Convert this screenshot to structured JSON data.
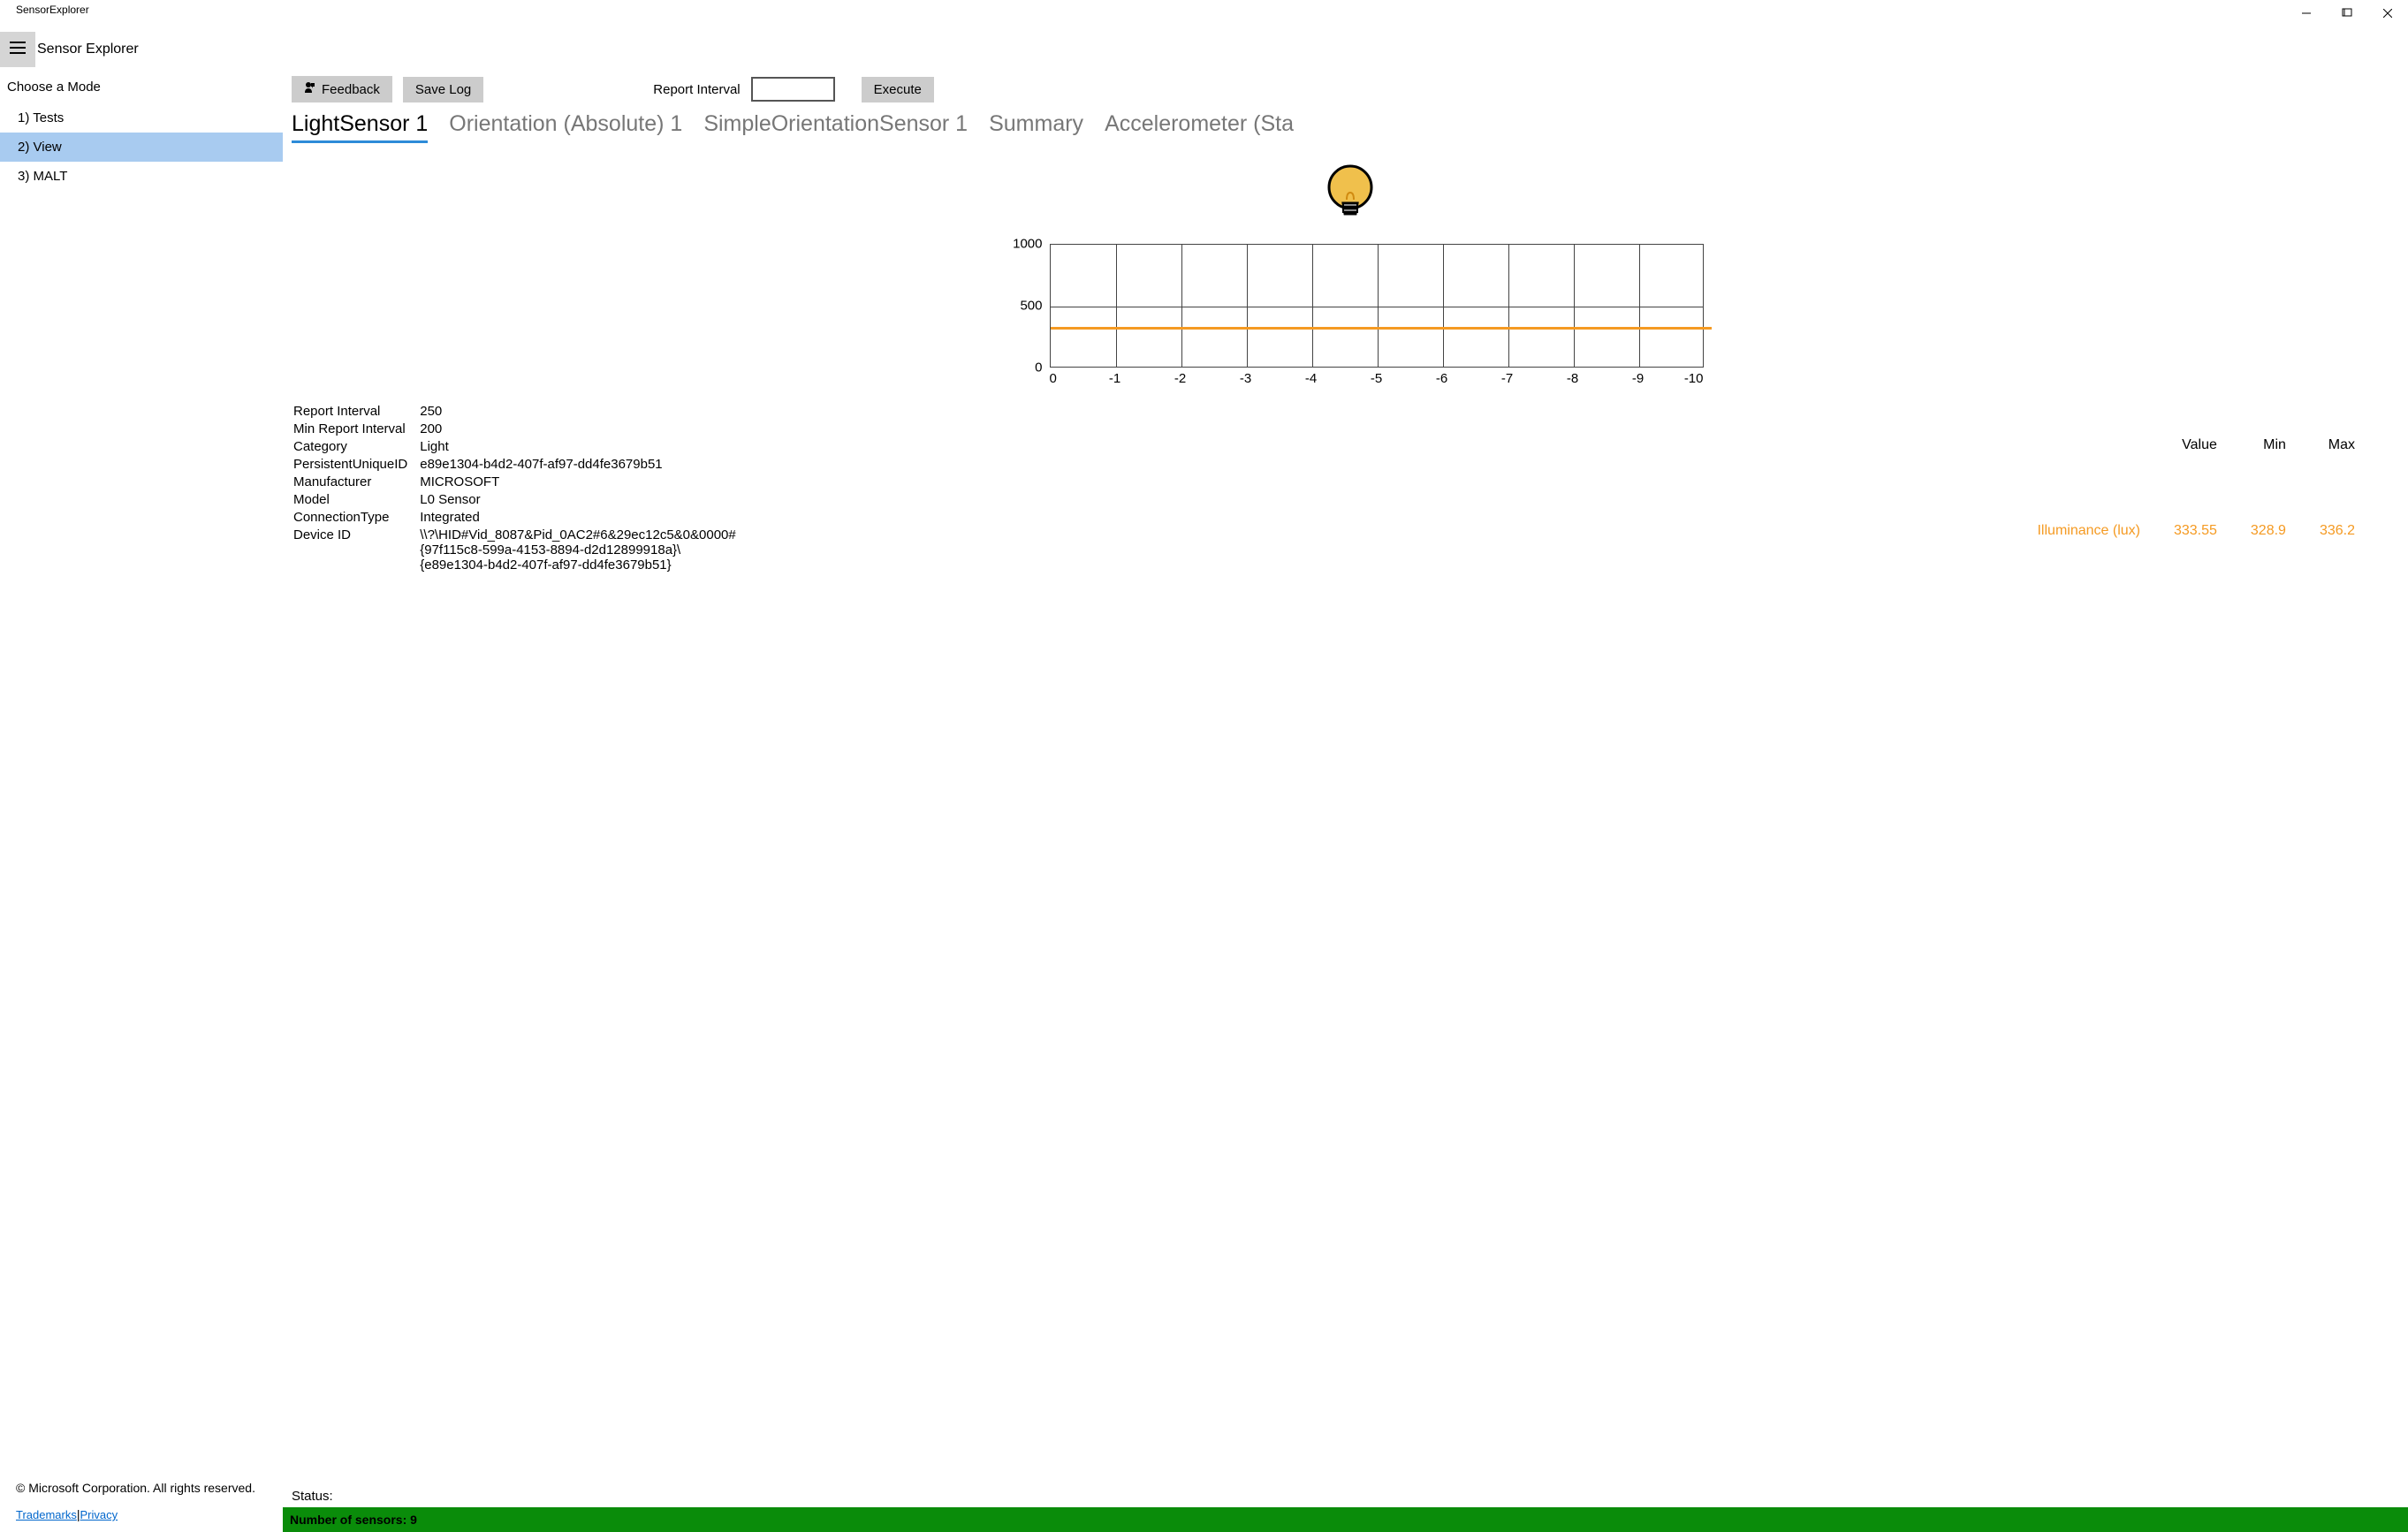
{
  "window": {
    "title": "SensorExplorer"
  },
  "header": {
    "app_title": "Sensor Explorer",
    "hamburger_icon": "menu-icon"
  },
  "sidebar": {
    "choose_label": "Choose a Mode",
    "items": [
      {
        "label": "1) Tests",
        "selected": false
      },
      {
        "label": "2) View",
        "selected": true
      },
      {
        "label": "3) MALT",
        "selected": false
      }
    ],
    "copyright": "© Microsoft Corporation. All rights reserved.",
    "links": {
      "trademarks": "Trademarks",
      "sep": "|",
      "privacy": "Privacy"
    }
  },
  "toolbar": {
    "feedback_label": "Feedback",
    "savelog_label": "Save Log",
    "report_interval_label": "Report Interval",
    "report_interval_value": "",
    "execute_label": "Execute"
  },
  "tabs": [
    {
      "label": "LightSensor 1",
      "active": true
    },
    {
      "label": "Orientation (Absolute) 1",
      "active": false
    },
    {
      "label": "SimpleOrientationSensor 1",
      "active": false
    },
    {
      "label": "Summary",
      "active": false
    },
    {
      "label": "Accelerometer (Sta",
      "active": false
    }
  ],
  "chart_data": {
    "type": "line",
    "title": "",
    "xlabel": "",
    "ylabel": "",
    "categories": [
      "0",
      "-1",
      "-2",
      "-3",
      "-4",
      "-5",
      "-6",
      "-7",
      "-8",
      "-9",
      "-10"
    ],
    "y_ticks": [
      "0",
      "500",
      "1000"
    ],
    "ylim": [
      0,
      1000
    ],
    "series": [
      {
        "name": "Illuminance (lux)",
        "values": [
          333.55,
          333,
          333,
          333,
          333,
          333,
          333,
          333,
          333,
          333,
          333
        ]
      }
    ]
  },
  "readings": {
    "header": {
      "value": "Value",
      "min": "Min",
      "max": "Max"
    },
    "rows": [
      {
        "name": "Illuminance (lux)",
        "value": "333.55",
        "min": "328.9",
        "max": "336.2"
      }
    ]
  },
  "info": {
    "rows": [
      {
        "k": "Report Interval",
        "v": "250"
      },
      {
        "k": "Min Report Interval",
        "v": "200"
      },
      {
        "k": "Category",
        "v": "Light"
      },
      {
        "k": "PersistentUniqueID",
        "v": "e89e1304-b4d2-407f-af97-dd4fe3679b51"
      },
      {
        "k": "Manufacturer",
        "v": "MICROSOFT"
      },
      {
        "k": "Model",
        "v": "L0 Sensor"
      },
      {
        "k": "ConnectionType",
        "v": "Integrated"
      },
      {
        "k": "Device ID",
        "v": "\\\\?\\HID#Vid_8087&Pid_0AC2#6&29ec12c5&0&0000#\n{97f115c8-599a-4153-8894-d2d12899918a}\\\n{e89e1304-b4d2-407f-af97-dd4fe3679b51}"
      }
    ]
  },
  "status": {
    "label": "Status:"
  },
  "footer_bar": {
    "text": "Number of sensors: 9"
  }
}
